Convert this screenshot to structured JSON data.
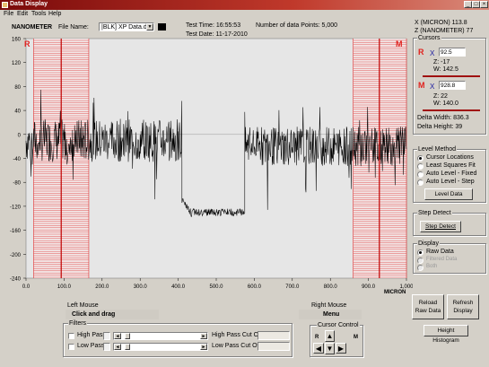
{
  "window": {
    "title": "Data Display"
  },
  "menu": [
    "File",
    "Edit",
    "Tools",
    "Help"
  ],
  "header": {
    "unit_label": "NANOMETER",
    "file_name_label": "File Name:",
    "file_name_value": "|BLK] XP Data.dat",
    "test_time": "Test Time: 16:55:53",
    "test_date": "Test Date: 11-17-2010",
    "points": "Number of data Points: 5,000"
  },
  "readout": {
    "x": "X (MICRON)  113.8",
    "z": "Z (NANOMETER)  77"
  },
  "cursors": {
    "title": "Cursors",
    "r": {
      "tag": "R",
      "x_label": "X",
      "x_value": "92.5",
      "z": "Z:  -17",
      "w": "W:  142.5"
    },
    "m": {
      "tag": "M",
      "x_label": "X",
      "x_value": "928.8",
      "z": "Z:  22",
      "w": "W:  140.0"
    },
    "delta_width": "Delta Width:  836.3",
    "delta_height": "Delta Height: 39"
  },
  "level": {
    "title": "Level Method",
    "options": [
      "Cursor Locations",
      "Least Squares Fit",
      "Auto Level - Fixed",
      "Auto Level - Step"
    ],
    "selected": 0,
    "button": "Level Data"
  },
  "step": {
    "title": "Step Detect",
    "button": "Step Detect"
  },
  "display": {
    "title": "Display",
    "options": [
      "Raw Data",
      "Filtered Data",
      "Both"
    ],
    "selected": 0
  },
  "buttons": {
    "reload": "Reload Raw Data",
    "refresh": "Refresh Display",
    "histogram": "Height Histogram"
  },
  "mouse": {
    "left_title": "Left Mouse",
    "left_action": "Click and drag",
    "right_title": "Right Mouse",
    "right_action": "Menu"
  },
  "filters": {
    "title": "Filters",
    "high_pass": "High Pass",
    "low_pass": "Low Pass",
    "high_cut": "High Pass Cut Off",
    "low_cut": "Low Pass Cut Off"
  },
  "cursor_control": {
    "title": "Cursor Control",
    "r": "R",
    "m": "M"
  },
  "chart_data": {
    "type": "line",
    "xlabel": "MICRON",
    "xlim": [
      0,
      1000
    ],
    "ylim": [
      -240,
      160
    ],
    "xticks": [
      "0.0",
      "100.0",
      "200.0",
      "300.0",
      "400.0",
      "500.0",
      "600.0",
      "700.0",
      "800.0",
      "900.0",
      "1,000"
    ],
    "yticks": [
      "160",
      "120",
      "80",
      "40",
      "0",
      "-40",
      "-80",
      "-120",
      "-160",
      "-200",
      "-240"
    ],
    "cursor_r_x": 92.5,
    "cursor_m_x": 928.8,
    "cursor_r_band": [
      20,
      165
    ],
    "cursor_m_band": [
      860,
      1000
    ],
    "segments": [
      {
        "name": "noisy-left",
        "x": [
          0,
          410
        ],
        "base": -10,
        "amp": 60
      },
      {
        "name": "step-low",
        "x": [
          410,
          575
        ],
        "base": -130,
        "amp": 8
      },
      {
        "name": "noisy-right",
        "x": [
          575,
          1000
        ],
        "base": -20,
        "amp": 55
      }
    ]
  }
}
